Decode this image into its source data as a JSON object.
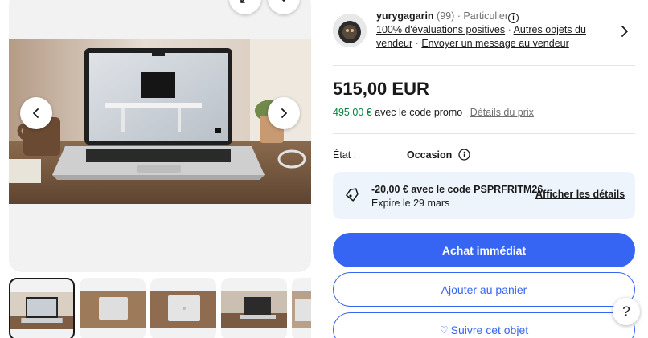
{
  "gallery": {
    "icons": {
      "expand": "expand-icon",
      "favorite": "heart-icon",
      "prev": "chevron-left-icon",
      "next": "chevron-right-icon"
    },
    "thumbnail_count": 5,
    "active_thumbnail": 1
  },
  "seller": {
    "name": "yurygagarin",
    "feedback_count": "(99)",
    "separator": "·",
    "type": "Particulier",
    "positive_feedback": "100% d'évaluations positives",
    "other_items": "Autres objets du vendeur",
    "contact": "Envoyer un message au vendeur"
  },
  "pricing": {
    "price": "515,00 EUR",
    "promo_price": "495,00 €",
    "promo_text": "avec le code promo",
    "price_details_link": "Détails du prix"
  },
  "condition": {
    "label": "État :",
    "value": "Occasion"
  },
  "coupon": {
    "title": "-20,00 € avec le code PSPRFRITM26",
    "expiry": "Expire le 29 mars",
    "details_link": "Afficher les détails"
  },
  "actions": {
    "buy_now": "Achat immédiat",
    "add_to_cart": "Ajouter au panier",
    "watch": "Suivre cet objet",
    "watch_icon": "♡"
  },
  "help": {
    "label": "?"
  },
  "colors": {
    "accent": "#3665f3",
    "promo_green": "#05823f",
    "coupon_bg": "#eef4fb"
  }
}
